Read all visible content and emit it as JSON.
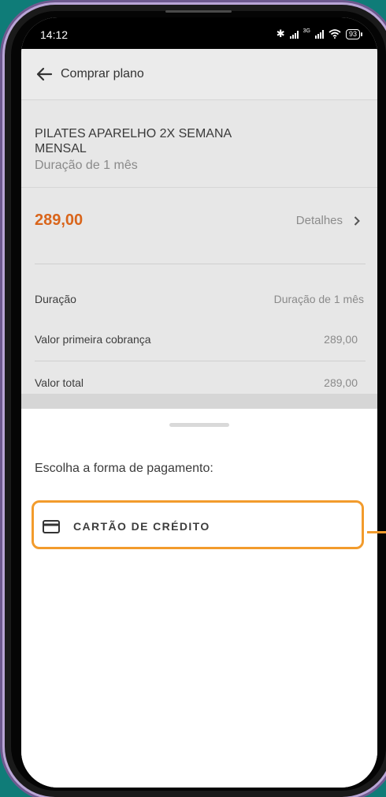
{
  "status_bar": {
    "time": "14:12",
    "network": "3G",
    "battery": "93"
  },
  "header": {
    "back_icon": "arrow-left-icon",
    "title": "Comprar plano"
  },
  "plan": {
    "name": "PILATES APARELHO 2X SEMANA MENSAL",
    "duration": "Duração de 1 mês"
  },
  "pricing": {
    "price": "289,00",
    "price_color": "#d9651b",
    "details_label": "Detalhes",
    "rows": [
      {
        "label": "Duração",
        "value": "Duração de 1 mês"
      },
      {
        "label": "Valor primeira cobrança",
        "value": "289,00"
      },
      {
        "label": "Valor total",
        "value": "289,00"
      }
    ]
  },
  "payment_sheet": {
    "prompt": "Escolha a forma de pagamento:",
    "options": [
      {
        "label": "CARTÃO DE CRÉDITO",
        "icon": "credit-card-icon"
      }
    ],
    "highlight_color": "#f29b2c"
  }
}
